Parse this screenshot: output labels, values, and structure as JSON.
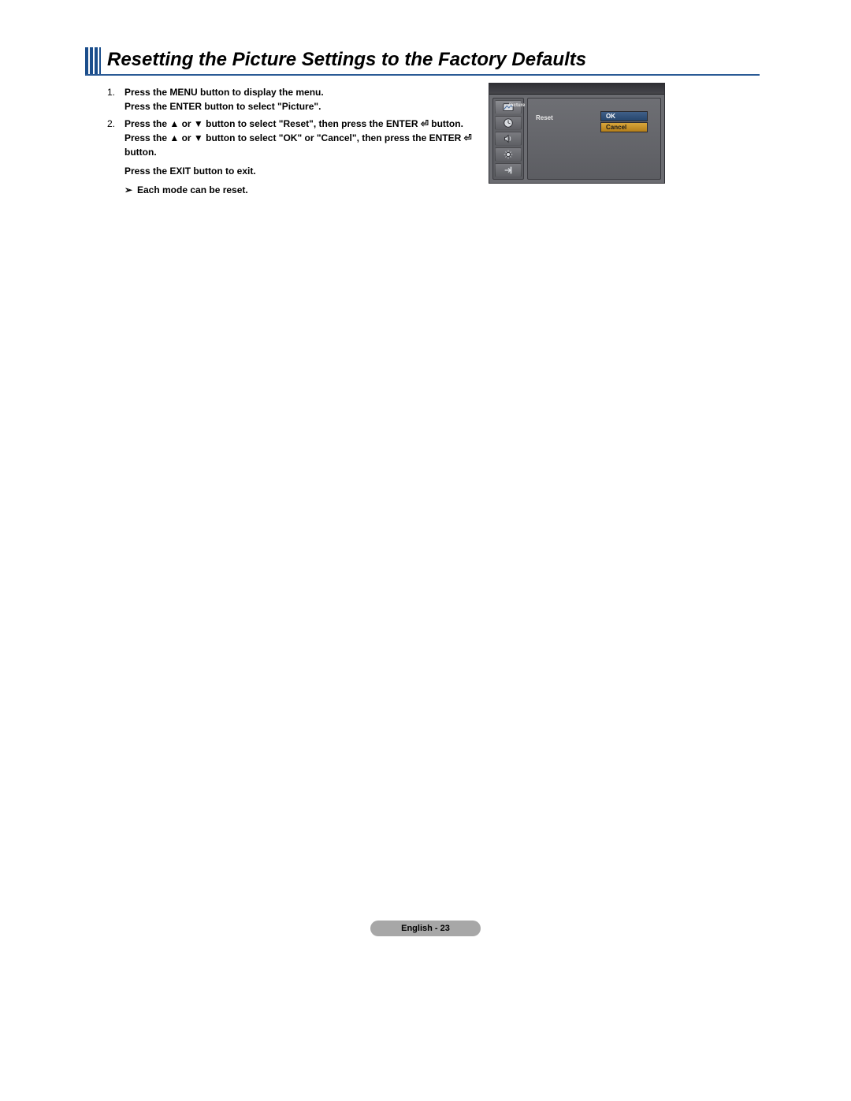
{
  "heading": "Resetting the Picture Settings to the Factory Defaults",
  "steps": [
    {
      "num": "1.",
      "lines": [
        "Press the MENU button to display the menu.",
        "Press the ENTER button to select \"Picture\"."
      ]
    },
    {
      "num": "2.",
      "lines": [
        "Press the ▲ or ▼ button to select \"Reset\", then press the ENTER ⏎ button.",
        "Press the ▲ or ▼ button to select \"OK\" or \"Cancel\", then press the ENTER ⏎",
        "button.",
        "Press the EXIT button to exit."
      ]
    }
  ],
  "note": "Each mode can be reset.",
  "tvui": {
    "side_active_label": "Picture",
    "side_icons": [
      "picture-icon",
      "clock-icon",
      "speaker-icon",
      "tools-icon",
      "input-icon"
    ],
    "left_label": "Reset",
    "option_ok": "OK",
    "option_cancel": "Cancel"
  },
  "footer": "English - 23"
}
